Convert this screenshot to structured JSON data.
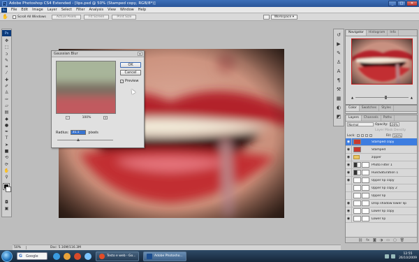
{
  "window": {
    "title": "Adobe Photoshop CS4 Extended - [lips.psd @ 50% (Stamped copy, RGB/8*)]",
    "app_badge": "Ps",
    "min": "_",
    "max": "□",
    "close": "✕"
  },
  "menu": [
    "File",
    "Edit",
    "Image",
    "Layer",
    "Select",
    "Filter",
    "Analysis",
    "View",
    "Window",
    "Help"
  ],
  "options": {
    "scroll_all_windows": "Scroll All Windows",
    "actual_pixels": "Actual Pixels",
    "fit_screen": "Fit Screen",
    "print_size": "Print Size",
    "workspace": "Workspace ▾"
  },
  "tools": [
    "move-icon",
    "marquee-icon",
    "lasso-icon",
    "quick-select-icon",
    "crop-icon",
    "eyedropper-icon",
    "healing-icon",
    "brush-icon",
    "clone-stamp-icon",
    "history-brush-icon",
    "eraser-icon",
    "gradient-icon",
    "blur-icon",
    "dodge-icon",
    "pen-icon",
    "type-icon",
    "path-select-icon",
    "shape-icon",
    "3d-rotate-icon",
    "3d-camera-icon",
    "hand-icon",
    "zoom-icon"
  ],
  "dialog": {
    "title": "Gaussian Blur",
    "ok": "OK",
    "cancel": "Cancel",
    "preview_label": "Preview",
    "preview_checked": true,
    "zoom": "100%",
    "radius_label": "Radius:",
    "radius_value": "31.1",
    "radius_unit": "pixels"
  },
  "status": {
    "zoom": "50%",
    "doc": "Doc: 5.16M/116.3M"
  },
  "navigator": {
    "tabs": [
      "Navigator",
      "Histogram",
      "Info"
    ]
  },
  "color_panel": {
    "tabs": [
      "Color",
      "Swatches",
      "Styles"
    ]
  },
  "layers_panel": {
    "tabs": [
      "Layers",
      "Channels",
      "Paths"
    ],
    "blend_mode": "Normal",
    "opacity_label": "Opacity:",
    "opacity": "100%",
    "layer_mask_density": "Layer Mask Density",
    "lock_label": "Lock:",
    "fill_label": "Fill:",
    "fill": "100%",
    "layers": [
      {
        "name": "Stamped copy",
        "visible": true,
        "selected": true,
        "thumb": "lip"
      },
      {
        "name": "Stamped",
        "visible": true,
        "selected": false,
        "thumb": "lip"
      },
      {
        "name": "zipper",
        "visible": true,
        "selected": false,
        "thumb": "folder"
      },
      {
        "name": "Photo Filter 1",
        "visible": true,
        "selected": false,
        "thumb": "adj"
      },
      {
        "name": "Hue/Saturation 1",
        "visible": true,
        "selected": false,
        "thumb": "adj"
      },
      {
        "name": "Upper lip copy",
        "visible": true,
        "selected": false,
        "thumb": "mask"
      },
      {
        "name": "Upper lip copy 2",
        "visible": false,
        "selected": false,
        "thumb": "mask"
      },
      {
        "name": "Upper lip",
        "visible": false,
        "selected": false,
        "thumb": "mask"
      },
      {
        "name": "Drop shadow lower lip",
        "visible": true,
        "selected": false,
        "thumb": "mask"
      },
      {
        "name": "Lower lip copy",
        "visible": true,
        "selected": false,
        "thumb": "mask"
      },
      {
        "name": "Lower lip",
        "visible": true,
        "selected": false,
        "thumb": "mask"
      }
    ]
  },
  "taskbar": {
    "search": "Google",
    "tasks": [
      {
        "label": "Testo e web - Go...",
        "active": false
      },
      {
        "label": "Adobe Photosho...",
        "active": true
      }
    ],
    "time": "12:55",
    "date": "26/10/2009"
  },
  "colors": {
    "title_bar": "#2a5598",
    "selection": "#3d7de0",
    "lip_red": "#b3242a"
  }
}
